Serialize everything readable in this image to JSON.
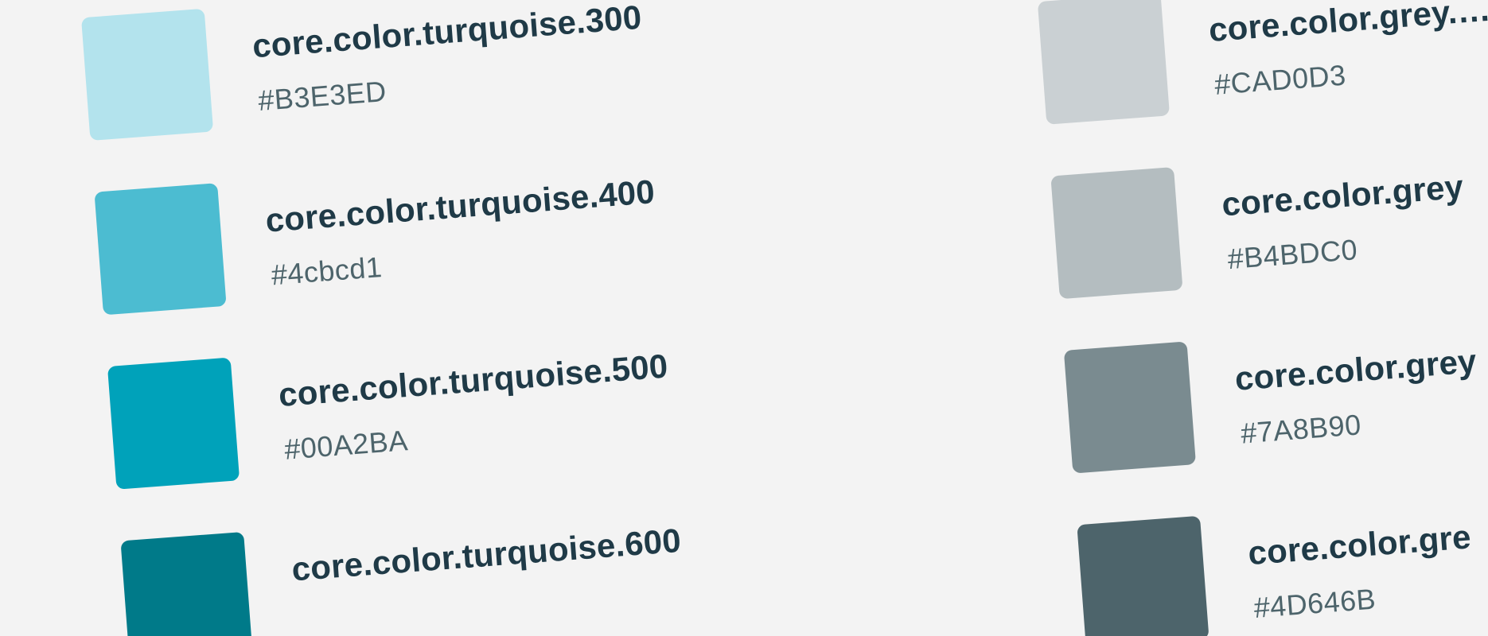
{
  "left_column": [
    {
      "token": "",
      "hex": "",
      "color": "#d6f0f5"
    },
    {
      "token": "core.color.turquoise.300",
      "hex": "#B3E3ED",
      "color": "#B3E3ED"
    },
    {
      "token": "core.color.turquoise.400",
      "hex": "#4cbcd1",
      "color": "#4cbcd1"
    },
    {
      "token": "core.color.turquoise.500",
      "hex": "#00A2BA",
      "color": "#00A2BA"
    },
    {
      "token": "core.color.turquoise.600",
      "hex": "",
      "color": "#007A89"
    }
  ],
  "right_column": [
    {
      "token": "core.color.grey.…",
      "hex": "#CAD0D3",
      "color": "#CAD0D3"
    },
    {
      "token": "core.color.grey",
      "hex": "#B4BDC0",
      "color": "#B4BDC0"
    },
    {
      "token": "core.color.grey",
      "hex": "#7A8B90",
      "color": "#7A8B90"
    },
    {
      "token": "core.color.gre",
      "hex": "#4D646B",
      "color": "#4D646B"
    }
  ],
  "colors": {
    "background": "#f3f3f3",
    "token_text": "#1f3a47",
    "hex_text": "#4d646b"
  }
}
